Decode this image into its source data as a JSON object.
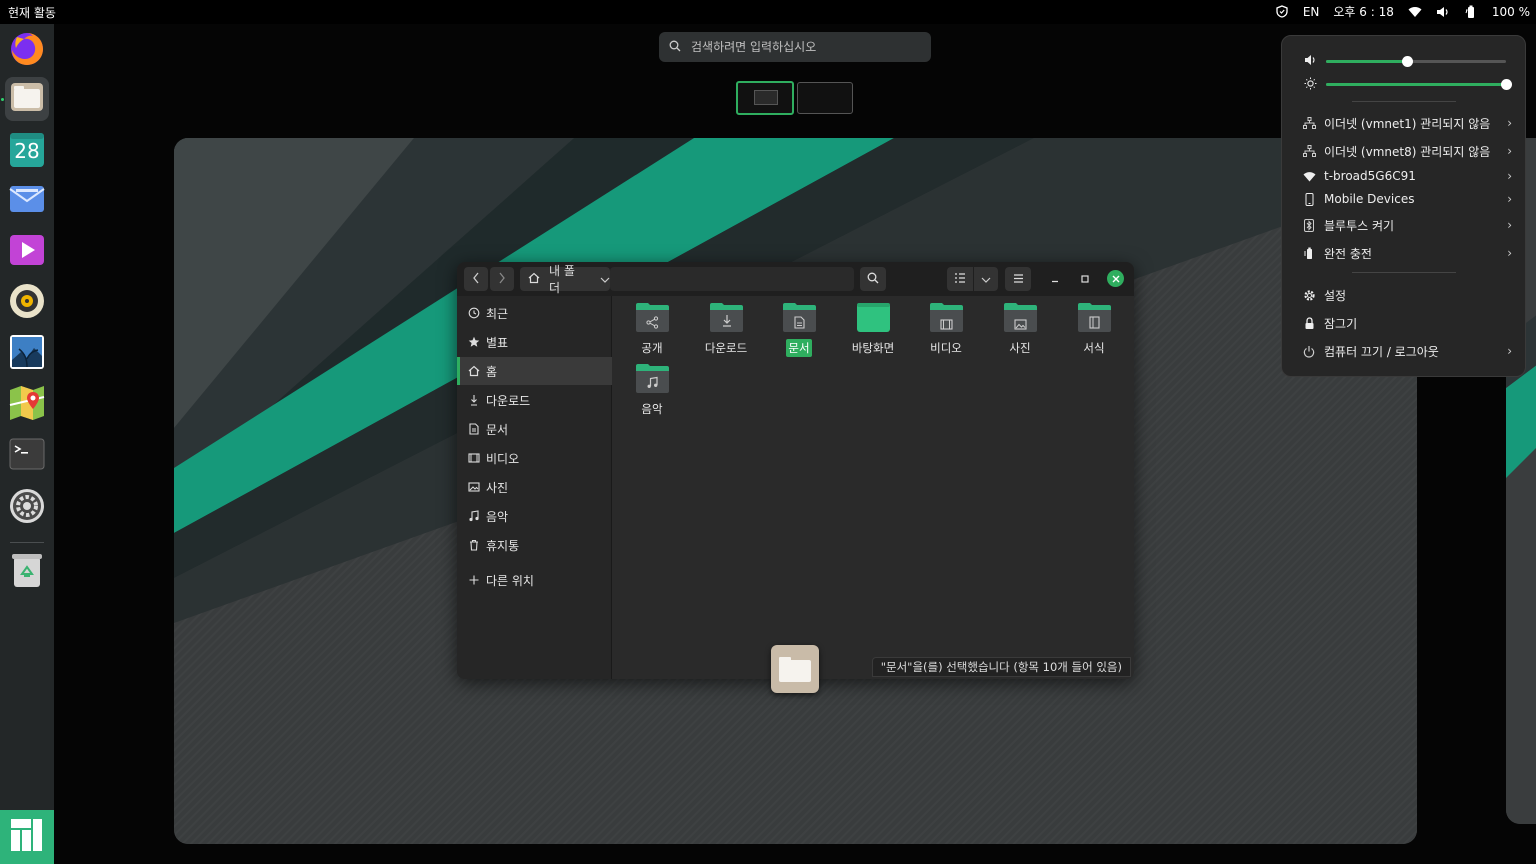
{
  "topbar": {
    "activities": "현재 활동",
    "lang": "EN",
    "clock": "오후 6 : 18",
    "battery": "100 %"
  },
  "dock": {
    "apps": [
      "firefox-icon",
      "files-icon",
      "calendar-icon",
      "mail-icon",
      "video-icon",
      "music-icon",
      "image-viewer-icon",
      "maps-icon",
      "terminal-icon",
      "settings-icon",
      "trash-icon"
    ],
    "calendar_day": "28"
  },
  "search": {
    "placeholder": "검색하려면 입력하십시오"
  },
  "files": {
    "path_label": "내 폴더",
    "sidebar": [
      {
        "label": "최근",
        "icon": "clock-icon"
      },
      {
        "label": "별표",
        "icon": "star-icon"
      },
      {
        "label": "홈",
        "icon": "home-icon"
      },
      {
        "label": "다운로드",
        "icon": "download-icon"
      },
      {
        "label": "문서",
        "icon": "document-icon"
      },
      {
        "label": "비디오",
        "icon": "film-icon"
      },
      {
        "label": "사진",
        "icon": "picture-icon"
      },
      {
        "label": "음악",
        "icon": "music-note-icon"
      },
      {
        "label": "휴지통",
        "icon": "trash-icon"
      },
      {
        "label": "다른 위치",
        "icon": "plus-icon"
      }
    ],
    "selected_sidebar": "홈",
    "folders": [
      {
        "label": "공개",
        "icon": "share-icon"
      },
      {
        "label": "다운로드",
        "icon": "download-icon"
      },
      {
        "label": "문서",
        "icon": "document-icon"
      },
      {
        "label": "바탕화면",
        "icon": "desktop-icon"
      },
      {
        "label": "비디오",
        "icon": "film-icon"
      },
      {
        "label": "사진",
        "icon": "picture-icon"
      },
      {
        "label": "서식",
        "icon": "template-icon"
      },
      {
        "label": "음악",
        "icon": "music-note-icon"
      }
    ],
    "selected_folder": "문서",
    "status": "\"문서\"을(를) 선택했습니다 (항목 10개 들어 있음)"
  },
  "system_menu": {
    "volume_level": 0.45,
    "brightness_level": 1.0,
    "items": [
      {
        "label": "이더넷 (vmnet1) 관리되지 않음",
        "icon": "ethernet-icon",
        "chevron": true
      },
      {
        "label": "이더넷 (vmnet8) 관리되지 않음",
        "icon": "ethernet-icon",
        "chevron": true
      },
      {
        "label": "t-broad5G6C91",
        "icon": "wifi-icon",
        "chevron": true
      },
      {
        "label": "Mobile Devices",
        "icon": "phone-icon",
        "chevron": true
      },
      {
        "label": "블루투스 켜기",
        "icon": "bluetooth-icon",
        "chevron": true
      },
      {
        "label": "완전 충전",
        "icon": "battery-icon",
        "chevron": true
      },
      {
        "label": "설정",
        "icon": "gear-icon",
        "chevron": false
      },
      {
        "label": "잠그기",
        "icon": "lock-icon",
        "chevron": false
      },
      {
        "label": "컴퓨터 끄기 / 로그아웃",
        "icon": "power-icon",
        "chevron": true
      }
    ]
  },
  "colors": {
    "accent": "#2fae5f",
    "folder": "#2eb37a",
    "teal_stripe": "#16997a"
  }
}
